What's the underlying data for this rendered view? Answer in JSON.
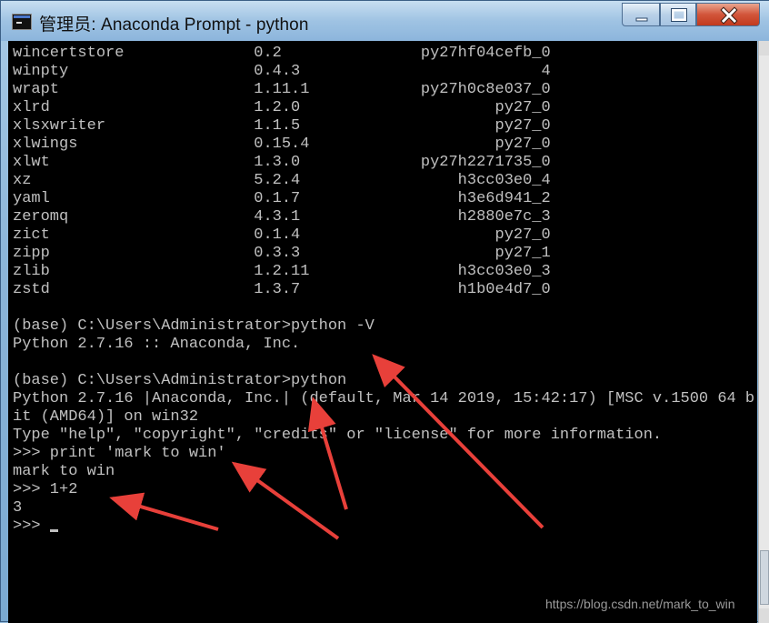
{
  "window": {
    "title": "管理员: Anaconda Prompt - python",
    "icon": "console-icon"
  },
  "controls": {
    "minimize": "minimize-icon",
    "maximize": "maximize-icon",
    "close": "close-icon"
  },
  "console": {
    "lines": [
      "wincertstore              0.2               py27hf04cefb_0",
      "winpty                    0.4.3                          4",
      "wrapt                     1.11.1            py27h0c8e037_0",
      "xlrd                      1.2.0                     py27_0",
      "xlsxwriter                1.1.5                     py27_0",
      "xlwings                   0.15.4                    py27_0",
      "xlwt                      1.3.0             py27h2271735_0",
      "xz                        5.2.4                 h3cc03e0_4",
      "yaml                      0.1.7                 h3e6d941_2",
      "zeromq                    4.3.1                 h2880e7c_3",
      "zict                      0.1.4                     py27_0",
      "zipp                      0.3.3                     py27_1",
      "zlib                      1.2.11                h3cc03e0_3",
      "zstd                      1.3.7                 h1b0e4d7_0",
      "",
      "(base) C:\\Users\\Administrator>python -V",
      "Python 2.7.16 :: Anaconda, Inc.",
      "",
      "(base) C:\\Users\\Administrator>python",
      "Python 2.7.16 |Anaconda, Inc.| (default, Mar 14 2019, 15:42:17) [MSC v.1500 64 b",
      "it (AMD64)] on win32",
      "Type \"help\", \"copyright\", \"credits\" or \"license\" for more information.",
      ">>> print 'mark to win'",
      "mark to win",
      ">>> 1+2",
      "3",
      ">>> "
    ]
  },
  "watermark": "https://blog.csdn.net/mark_to_win",
  "colors": {
    "console_bg": "#000000",
    "console_text": "#c0c0c0",
    "annotation_arrow": "#e8403a"
  }
}
